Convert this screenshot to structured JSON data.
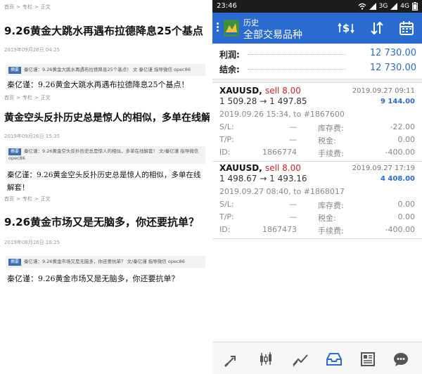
{
  "articles": [
    {
      "crumb": [
        "首页",
        ">",
        "专栏",
        ">",
        "正文"
      ],
      "title": "9.26黄金大跳水再遇布拉德降息25个基点",
      "date": "2019年09月26日 04:25",
      "summary_tag": "摘要",
      "summary": "秦亿谨：9.26黄金大跳水再遇布拉德降息25个基点！ 文 秦亿谨 指导微信 opec86",
      "body": "秦亿谨：9.26黄金大跳水再遇布拉德降息25个基点！"
    },
    {
      "crumb": [
        "首页",
        ">",
        "专栏",
        ">",
        "正文"
      ],
      "title": "黄金空头反扑历史总是惊人的相似，多单在线解",
      "date": "2019年09月26日 15:35",
      "summary_tag": "摘要",
      "summary": "秦亿谨：9.26黄金空头反扑历史总是惊人的相似，多单在线解套！ 文/秦亿谨 指导微信 opec86",
      "body_line1": "秦亿谨：9.26黄金空头反扑历史总是惊人的相似，多单在线",
      "body_line2": "解套！"
    },
    {
      "crumb": [
        "首页",
        ">",
        "专栏",
        ">",
        "正文"
      ],
      "title": "9.26黄金市场又是无脑多，你还要抗单？",
      "date": "2019年09月26日 16:25",
      "summary_tag": "摘要",
      "summary": "秦亿谨：9.26黄金市场又是无脑多，你还要抗单？ 文/秦亿谨 指导微信 opec86",
      "body": "秦亿谨：9.26黄金市场又是无脑多，你还要抗单？"
    }
  ],
  "phone": {
    "status": {
      "time": "23:46",
      "sig1": "3G",
      "sig2": "4G"
    },
    "appbar": {
      "subtitle": "历史",
      "title": "全部交易品种"
    },
    "summary": [
      {
        "label": "利润:",
        "value": "12 730.00"
      },
      {
        "label": "结余:",
        "value": "12 730.00"
      }
    ],
    "orders": [
      {
        "symbol": "XAUUSD,",
        "side": "sell 8.00",
        "datetime": "2019.09.27 09:11",
        "prices": "1 509.28 → 1 497.85",
        "profit": "9 144.00",
        "open": "2019.09.26 15:34, to #1867600",
        "sl_label": "S/L:",
        "sl": "—",
        "swap_label": "库存费:",
        "swap": "-22.00",
        "tp_label": "T/P:",
        "tp": "—",
        "tax_label": "税金:",
        "tax": "0.00",
        "id_label": "ID:",
        "id": "1866774",
        "fee_label": "手续费:",
        "fee": "-400.00"
      },
      {
        "symbol": "XAUUSD,",
        "side": "sell 8.00",
        "datetime": "2019.09.27 17:19",
        "prices": "1 498.67 → 1 493.16",
        "profit": "4 408.00",
        "open": "2019.09.27 08:40, to #1868017",
        "sl_label": "S/L:",
        "sl": "—",
        "swap_label": "库存费:",
        "swap": "0.00",
        "tp_label": "T/P:",
        "tp": "—",
        "tax_label": "税金:",
        "tax": "0.00",
        "id_label": "ID:",
        "id": "1867473",
        "fee_label": "手续费:",
        "fee": "-400.00"
      }
    ],
    "colors": {
      "accent": "#2a6bd1",
      "sell": "#d32222"
    },
    "bottom_nav": [
      "trade-icon",
      "candles-icon",
      "chart-icon",
      "history-icon",
      "news-icon",
      "chat-icon"
    ]
  }
}
